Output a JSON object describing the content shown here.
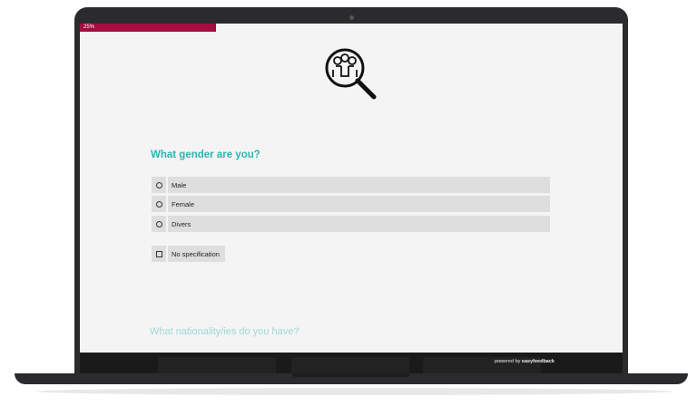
{
  "progress": {
    "label": "25%",
    "value_percent": 25,
    "color": "#a50d3c"
  },
  "survey": {
    "question": "What gender are you?",
    "options": [
      {
        "label": "Male"
      },
      {
        "label": "Female"
      },
      {
        "label": "Divers"
      }
    ],
    "no_spec": {
      "label": "No specification"
    },
    "next_question": "What nationality/ies do you have?"
  },
  "footer": {
    "powered_prefix": "powered by",
    "brand": "easyfeedback"
  },
  "colors": {
    "accent": "#2fb3b3",
    "progress": "#a50d3c"
  },
  "icons": {
    "hero": "people-magnifier-icon"
  }
}
